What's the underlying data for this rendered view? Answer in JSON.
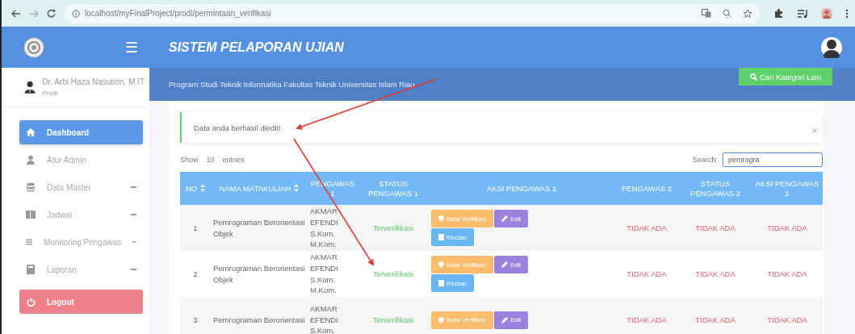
{
  "browser": {
    "url": "localhost/myFinalProject/prodi/permintaan_verifikasi"
  },
  "header": {
    "title": "SISTEM PELAPORAN UJIAN",
    "menu_glyph": "☰"
  },
  "sidebar": {
    "user": {
      "name": "Dr. Arbi Haza Nasution, M.IT",
      "role": "Prodi"
    },
    "items": [
      {
        "label": "Dashboard",
        "expandable": false,
        "selected": true
      },
      {
        "label": "Atur Admin",
        "expandable": false,
        "selected": false
      },
      {
        "label": "Data Master",
        "expandable": true,
        "selected": false
      },
      {
        "label": "Jadwal",
        "expandable": true,
        "selected": false
      },
      {
        "label": "Monitoring Pengawas",
        "expandable": true,
        "selected": false
      },
      {
        "label": "Laporan",
        "expandable": true,
        "selected": false
      }
    ],
    "logout": "Logout"
  },
  "banner": {
    "subtitle": "Program Studi Teknik Informatika Fakultas Teknik Universitas Islam Riau",
    "search_button": "Cari Kategori Lain"
  },
  "alert": {
    "message": "Data anda berhasil diedit!",
    "close": "×"
  },
  "table_controls": {
    "show_label": "Show",
    "entries_value": "10",
    "entries_label": "entries",
    "search_label": "Search:",
    "search_value": "pemrogra"
  },
  "table": {
    "columns": [
      {
        "label": "NO",
        "sortable": true
      },
      {
        "label": "NAMA MATAKULIAH",
        "sortable": true
      },
      {
        "label": "PENGAWAS 1",
        "sortable": false
      },
      {
        "label": "STATUS PENGAWAS 1",
        "sortable": false
      },
      {
        "label": "AKSI PENGAWAS 1",
        "sortable": false
      },
      {
        "label": "PENGAWAS 2",
        "sortable": false
      },
      {
        "label": "STATUS PENGAWAS 2",
        "sortable": false
      },
      {
        "label": "AKSI PENGAWAS 2",
        "sortable": false
      }
    ],
    "rows": [
      {
        "no": "1",
        "course": "Pemrograman Berorientasi Objek",
        "pengawas1": "AKMAR EFENDI S.Kom. M.Kom.",
        "status1": {
          "text": "Terverifikasi",
          "verified": true
        },
        "actions": [
          {
            "kind": "cancel",
            "label": "Batal Verifikasi"
          },
          {
            "kind": "edit",
            "label": "Edit"
          },
          {
            "kind": "detail",
            "label": "Rincian"
          }
        ],
        "pengawas2": "TIDAK ADA",
        "status2": "TIDAK ADA",
        "aksi2": "TIDAK ADA"
      },
      {
        "no": "2",
        "course": "Pemrograman Berorientasi Objek",
        "pengawas1": "AKMAR EFENDI S.Kom. M.Kom.",
        "status1": {
          "text": "Terverifikasi",
          "verified": true
        },
        "actions": [
          {
            "kind": "cancel",
            "label": "Batal Verifikasi"
          },
          {
            "kind": "edit",
            "label": "Edit"
          },
          {
            "kind": "detail",
            "label": "Rincian"
          }
        ],
        "pengawas2": "TIDAK ADA",
        "status2": "TIDAK ADA",
        "aksi2": "TIDAK ADA"
      },
      {
        "no": "3",
        "course": "Pemrograman Berorientasi",
        "pengawas1": "AKMAR EFENDI S.Kom.",
        "status1": {
          "text": "Terverifikasi",
          "verified": true
        },
        "actions": [
          {
            "kind": "cancel",
            "label": "Batal Verifikasi"
          },
          {
            "kind": "edit",
            "label": "Edit"
          }
        ],
        "pengawas2": "TIDAK ADA",
        "status2": "TIDAK ADA",
        "aksi2": "TIDAK ADA"
      }
    ]
  }
}
